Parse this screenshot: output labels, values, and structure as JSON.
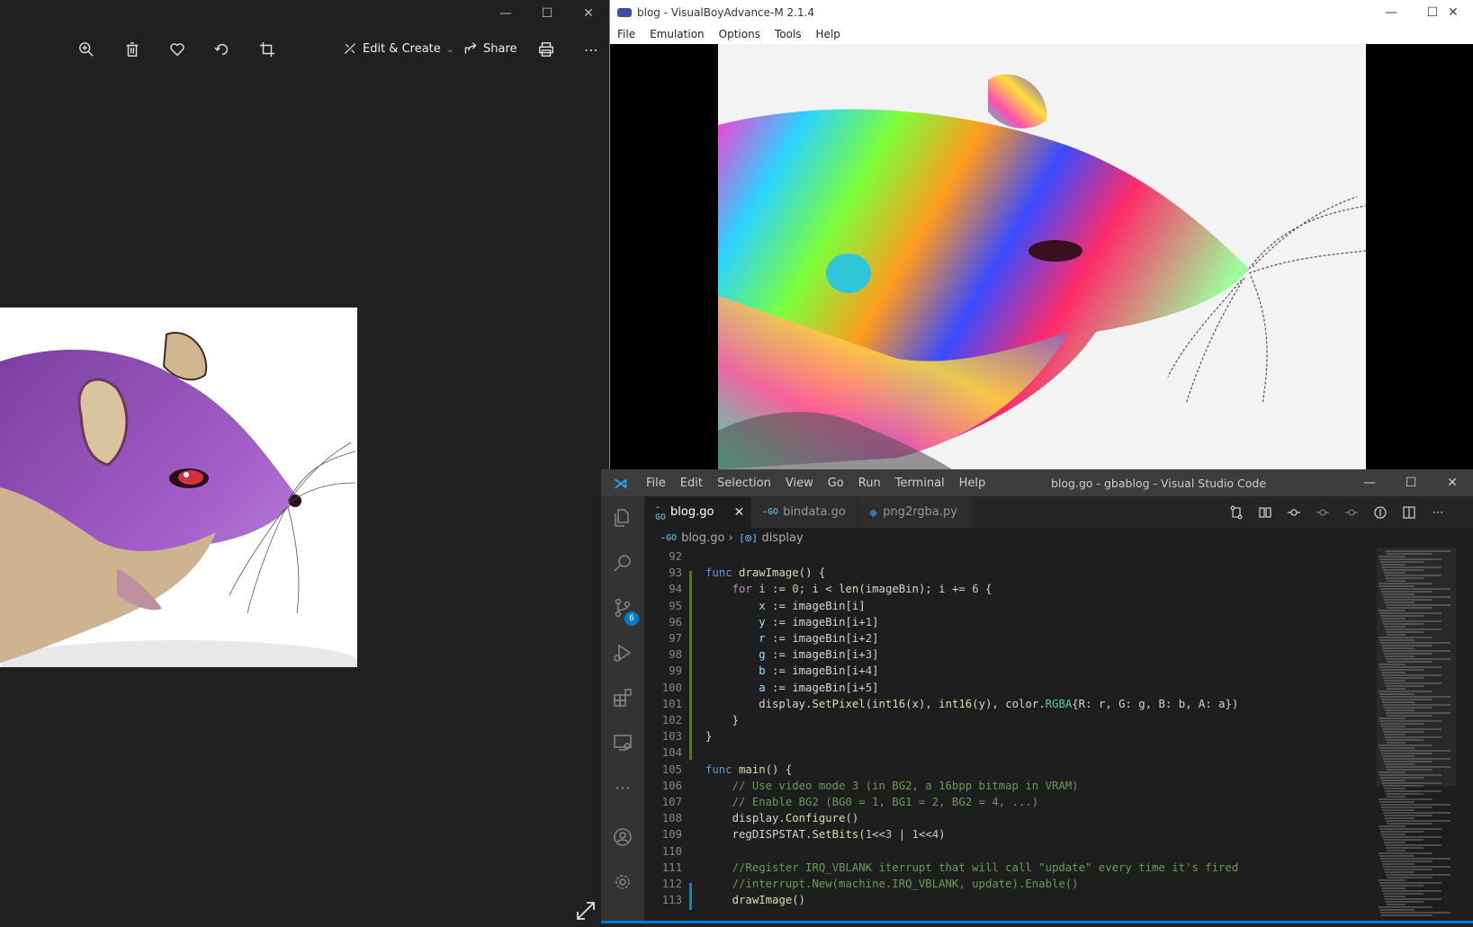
{
  "photos": {
    "toolbar": {
      "edit_create": "Edit & Create",
      "share": "Share"
    }
  },
  "vba": {
    "title": "blog - VisualBoyAdvance-M 2.1.4",
    "menu": [
      "File",
      "Emulation",
      "Options",
      "Tools",
      "Help"
    ]
  },
  "vscode": {
    "menu": [
      "File",
      "Edit",
      "Selection",
      "View",
      "Go",
      "Run",
      "Terminal",
      "Help"
    ],
    "title": "blog.go - gbablog - Visual Studio Code",
    "tabs": [
      {
        "label": "blog.go",
        "icon": "go-icon"
      },
      {
        "label": "bindata.go",
        "icon": "go-icon"
      },
      {
        "label": "png2rgba.py",
        "icon": "python-icon"
      }
    ],
    "breadcrumb": {
      "file": "blog.go",
      "symbol": "display"
    },
    "scm_badge": "6",
    "line_numbers": [
      "92",
      "93",
      "94",
      "95",
      "96",
      "97",
      "98",
      "99",
      "100",
      "101",
      "102",
      "103",
      "104",
      "105",
      "106",
      "107",
      "108",
      "109",
      "110",
      "111",
      "112",
      "113"
    ],
    "code_lines": [
      "",
      "func drawImage() {",
      "    for i := 0; i < len(imageBin); i += 6 {",
      "        x := imageBin[i]",
      "        y := imageBin[i+1]",
      "        r := imageBin[i+2]",
      "        g := imageBin[i+3]",
      "        b := imageBin[i+4]",
      "        a := imageBin[i+5]",
      "        display.SetPixel(int16(x), int16(y), color.RGBA{R: r, G: g, B: b, A: a})",
      "    }",
      "}",
      "",
      "func main() {",
      "    // Use video mode 3 (in BG2, a 16bpp bitmap in VRAM)",
      "    // Enable BG2 (BG0 = 1, BG1 = 2, BG2 = 4, ...)",
      "    display.Configure()",
      "    regDISPSTAT.SetBits(1<<3 | 1<<4)",
      "",
      "    //Register IRQ_VBLANK iterrupt that will call \"update\" every time it's fired",
      "    //interrupt.New(machine.IRQ_VBLANK, update).Enable()",
      "    drawImage()"
    ]
  }
}
